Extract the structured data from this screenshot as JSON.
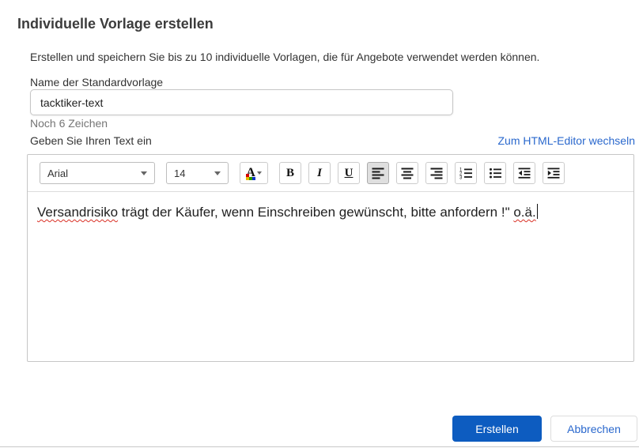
{
  "dialog": {
    "title": "Individuelle Vorlage erstellen",
    "description": "Erstellen und speichern Sie bis zu 10 individuelle Vorlagen, die für Angebote verwendet werden können."
  },
  "name_field": {
    "label": "Name der Standardvorlage",
    "value": "tacktiker-text",
    "remaining_chars_hint": "Noch 6 Zeichen"
  },
  "text_editor": {
    "label": "Geben Sie Ihren Text ein",
    "switch_editor_link": "Zum HTML-Editor wechseln",
    "toolbar": {
      "font_family": "Arial",
      "font_size": "14",
      "color_letter": "A",
      "bold": "B",
      "italic": "I",
      "underline": "U",
      "active_alignment": "left",
      "icons": [
        "font-color-icon",
        "align-left-icon",
        "align-center-icon",
        "align-right-icon",
        "ordered-list-icon",
        "unordered-list-icon",
        "outdent-icon",
        "indent-icon"
      ]
    },
    "content": {
      "misspelled_word_1": "Versandrisiko",
      "middle_text": " trägt der Käufer, wenn Einschreiben gewünscht, bitte anfordern !\" ",
      "misspelled_word_2": "o.ä."
    }
  },
  "footer": {
    "create_button": "Erstellen",
    "cancel_button": "Abbrechen"
  },
  "colors": {
    "primary_button_bg": "#0d5cc0",
    "link_text": "#2a68cd",
    "spellcheck_underline": "#d93025",
    "helper_text": "#757575",
    "active_toolbar_button_bg": "#dfdfdf"
  }
}
